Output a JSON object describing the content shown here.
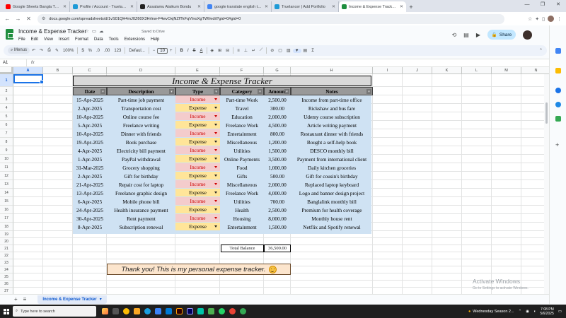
{
  "browser": {
    "tabs": [
      {
        "title": "Google Sheets Bangla Tutorial -",
        "color": "#ff0000"
      },
      {
        "title": "Profile / Account - Truelancer",
        "color": "#1e9ad6"
      },
      {
        "title": "Assalamu Alaikum Bondu",
        "color": "#222222"
      },
      {
        "title": "google translate english to bo...",
        "color": "#4285f4"
      },
      {
        "title": "Truelancer | Add Portfolio",
        "color": "#1e9ad6"
      },
      {
        "title": "Income & Expense Tracker - Go...",
        "color": "#1e8e3e"
      }
    ],
    "url": "docs.google.com/spreadsheets/d/1vS01QH4mJ0Z60X3Hrlnw-F4wvOxjNZfTkFqVInoXgTWI/edit?gid=0#gid=0"
  },
  "doc": {
    "title": "Income & Expense Tracker",
    "saved": "Saved to Drive",
    "menu": [
      "File",
      "Edit",
      "View",
      "Insert",
      "Format",
      "Data",
      "Tools",
      "Extensions",
      "Help"
    ],
    "share_label": "Share"
  },
  "toolbar": {
    "menus_label": "Menus",
    "zoom": "100%",
    "currency": "$",
    "percent": "%",
    "dec_less": ".0",
    "dec_more": ".00",
    "num_format": "123",
    "font": "Defaul...",
    "font_size": "10"
  },
  "formula": {
    "cell_ref": "A1",
    "fx": "fx"
  },
  "columns": [
    "A",
    "B",
    "C",
    "D",
    "E",
    "F",
    "G",
    "H",
    "I",
    "J",
    "K",
    "L",
    "M",
    "N"
  ],
  "rows": [
    "1",
    "2",
    "3",
    "4",
    "5",
    "6",
    "7",
    "8",
    "9",
    "10",
    "11",
    "12",
    "13",
    "14",
    "15",
    "16",
    "17",
    "18",
    "19",
    "20",
    "21",
    "22",
    "23",
    "24",
    "25",
    "26",
    "27"
  ],
  "sheet": {
    "title": "Income & Expense Tracker",
    "headers": [
      "Date",
      "Description",
      "Type",
      "Category",
      "Amount",
      "Notes"
    ],
    "rows": [
      {
        "date": "15-Apr-2025",
        "desc": "Part-time job payment",
        "type": "Income",
        "cat": "Part-time Work",
        "amount": "2,500.00",
        "notes": "Income from part-time office"
      },
      {
        "date": "2-Apr-2025",
        "desc": "Transportation cost",
        "type": "Expense",
        "cat": "Travel",
        "amount": "300.00",
        "notes": "Rickshaw and bus fare"
      },
      {
        "date": "10-Apr-2025",
        "desc": "Online course fee",
        "type": "Income",
        "cat": "Education",
        "amount": "2,000.00",
        "notes": "Udemy course subscription"
      },
      {
        "date": "5-Apr-2025",
        "desc": "Freelance writing",
        "type": "Expense",
        "cat": "Freelance Work",
        "amount": "4,500.00",
        "notes": "Article writing payment"
      },
      {
        "date": "10-Apr-2025",
        "desc": "Dinner with friends",
        "type": "Income",
        "cat": "Entertainment",
        "amount": "800.00",
        "notes": "Restaurant dinner with friends"
      },
      {
        "date": "19-Apr-2025",
        "desc": "Book purchase",
        "type": "Expense",
        "cat": "Miscellaneous",
        "amount": "1,200.00",
        "notes": "Bought a self-help book"
      },
      {
        "date": "4-Apr-2025",
        "desc": "Electricity bill payment",
        "type": "Income",
        "cat": "Utilities",
        "amount": "1,500.00",
        "notes": "DESCO monthly bill"
      },
      {
        "date": "1-Apr-2025",
        "desc": "PayPal withdrawal",
        "type": "Expense",
        "cat": "Online Payments",
        "amount": "3,500.00",
        "notes": "Payment from international client"
      },
      {
        "date": "31-Mar-2025",
        "desc": "Grocery shopping",
        "type": "Income",
        "cat": "Food",
        "amount": "1,000.00",
        "notes": "Daily kitchen groceries"
      },
      {
        "date": "2-Apr-2025",
        "desc": "Gift for birthday",
        "type": "Expense",
        "cat": "Gifts",
        "amount": "500.00",
        "notes": "Gift for cousin's birthday"
      },
      {
        "date": "21-Apr-2025",
        "desc": "Repair cost for laptop",
        "type": "Income",
        "cat": "Miscellaneous",
        "amount": "2,000.00",
        "notes": "Replaced laptop keyboard"
      },
      {
        "date": "13-Apr-2025",
        "desc": "Freelance graphic design",
        "type": "Expense",
        "cat": "Freelance Work",
        "amount": "4,000.00",
        "notes": "Logo and banner design project"
      },
      {
        "date": "6-Apr-2025",
        "desc": "Mobile phone bill",
        "type": "Income",
        "cat": "Utilities",
        "amount": "700.00",
        "notes": "Banglalink monthly bill"
      },
      {
        "date": "24-Apr-2025",
        "desc": "Health insurance payment",
        "type": "Expense",
        "cat": "Health",
        "amount": "2,500.00",
        "notes": "Premium for health coverage"
      },
      {
        "date": "30-Apr-2025",
        "desc": "Rent payment",
        "type": "Income",
        "cat": "Housing",
        "amount": "8,000.00",
        "notes": "Monthly house rent"
      },
      {
        "date": "8-Apr-2025",
        "desc": "Subscription renewal",
        "type": "Expense",
        "cat": "Entertainment",
        "amount": "1,500.00",
        "notes": "Netflix and Spotify renewal"
      }
    ],
    "total_label": "Total Balance",
    "total_value": "36,500.00",
    "thanks": "Thank you! This is my personal expense tracker."
  },
  "sheet_tab": "Income & Expense Tracker",
  "watermark": {
    "line1": "Activate Windows",
    "line2": "Go to Settings to activate Windows."
  },
  "taskbar": {
    "search_placeholder": "Type here to search",
    "weather": "Wednesday Season 2...",
    "time": "7:08 PM",
    "date": "5/6/2025"
  }
}
